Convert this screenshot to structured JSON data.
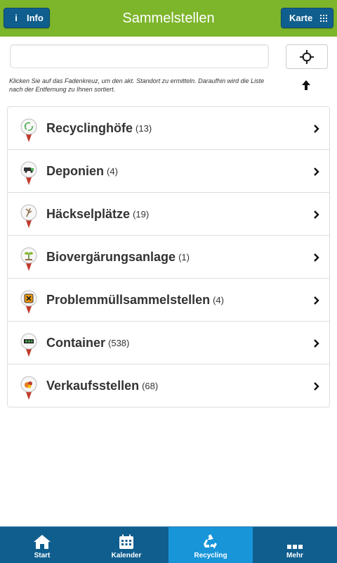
{
  "header": {
    "title": "Sammelstellen",
    "info_label": "Info",
    "map_label": "Karte",
    "accent": "#7db52b",
    "button_color": "#0f5e8e"
  },
  "search": {
    "value": "",
    "placeholder": ""
  },
  "hint": "Klicken Sie auf das Fadenkreuz, um den akt. Standort zu ermitteln. Daraufhin wird die Liste nach der Entfernung zu Ihnen sortiert.",
  "categories": [
    {
      "label": "Recyclinghöfe",
      "count": "(13)",
      "icon": "recycling-icon"
    },
    {
      "label": "Deponien",
      "count": "(4)",
      "icon": "truck-icon"
    },
    {
      "label": "Häckselplätze",
      "count": "(19)",
      "icon": "branch-icon"
    },
    {
      "label": "Biovergärungsanlage",
      "count": "(1)",
      "icon": "sprout-icon"
    },
    {
      "label": "Problemmüllsammelstellen",
      "count": "(4)",
      "icon": "hazard-icon"
    },
    {
      "label": "Container",
      "count": "(538)",
      "icon": "container-icon"
    },
    {
      "label": "Verkaufsstellen",
      "count": "(68)",
      "icon": "shop-icon"
    }
  ],
  "tabs": [
    {
      "label": "Start",
      "icon": "home-icon",
      "active": false
    },
    {
      "label": "Kalender",
      "icon": "calendar-icon",
      "active": false
    },
    {
      "label": "Recycling",
      "icon": "recycling-icon",
      "active": true
    },
    {
      "label": "Mehr",
      "icon": "more-icon",
      "active": false
    }
  ]
}
